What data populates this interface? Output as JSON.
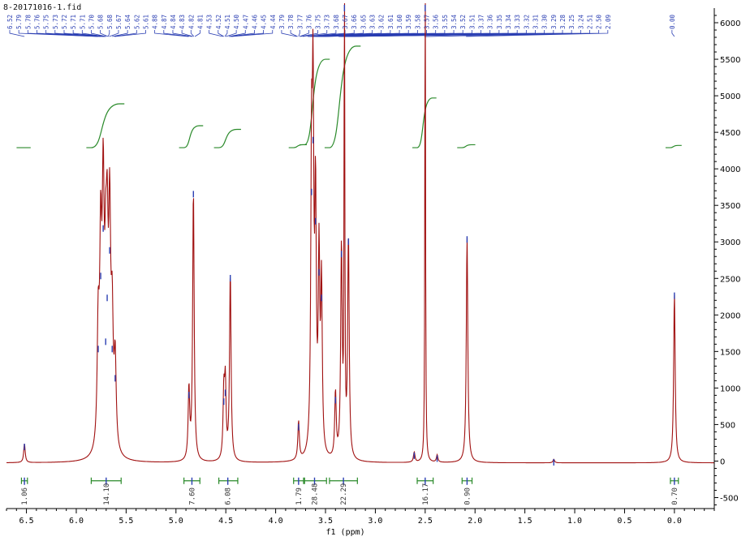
{
  "chart_data": {
    "type": "line",
    "title": "8-20171016-1.fid",
    "xlabel": "f1 (ppm)",
    "ylabel": "",
    "xlim": [
      6.7,
      -0.4
    ],
    "ylim": [
      -650,
      6200
    ],
    "x_ticks": [
      "6.5",
      "6.0",
      "5.5",
      "5.0",
      "4.5",
      "4.0",
      "3.5",
      "3.0",
      "2.5",
      "2.0",
      "1.5",
      "1.0",
      "0.5",
      "0.0"
    ],
    "y_ticks": [
      "-500",
      "0",
      "500",
      "1000",
      "1500",
      "2000",
      "2500",
      "3000",
      "3500",
      "4000",
      "4500",
      "5000",
      "5500",
      "6000"
    ],
    "peaks": [
      {
        "ppm": 6.52,
        "height": 260
      },
      {
        "ppm": 5.78,
        "height": 1600
      },
      {
        "ppm": 5.755,
        "height": 2600
      },
      {
        "ppm": 5.73,
        "height": 3250
      },
      {
        "ppm": 5.705,
        "height": 1700
      },
      {
        "ppm": 5.69,
        "height": 2300
      },
      {
        "ppm": 5.665,
        "height": 2950
      },
      {
        "ppm": 5.64,
        "height": 1600
      },
      {
        "ppm": 5.61,
        "height": 1200
      },
      {
        "ppm": 4.87,
        "height": 970
      },
      {
        "ppm": 4.825,
        "height": 3720
      },
      {
        "ppm": 4.52,
        "height": 880
      },
      {
        "ppm": 4.505,
        "height": 1000
      },
      {
        "ppm": 4.455,
        "height": 2570
      },
      {
        "ppm": 3.77,
        "height": 530
      },
      {
        "ppm": 3.64,
        "height": 3750
      },
      {
        "ppm": 3.625,
        "height": 4460
      },
      {
        "ppm": 3.6,
        "height": 3350
      },
      {
        "ppm": 3.565,
        "height": 2650
      },
      {
        "ppm": 3.54,
        "height": 2300
      },
      {
        "ppm": 3.4,
        "height": 900
      },
      {
        "ppm": 3.34,
        "height": 2900
      },
      {
        "ppm": 3.31,
        "height": 7200
      },
      {
        "ppm": 3.27,
        "height": 3070
      },
      {
        "ppm": 2.61,
        "height": 140
      },
      {
        "ppm": 2.5,
        "height": 7200
      },
      {
        "ppm": 2.38,
        "height": 100
      },
      {
        "ppm": 2.08,
        "height": 3100
      },
      {
        "ppm": 1.21,
        "height": 50
      },
      {
        "ppm": 0.0,
        "height": 2330
      }
    ],
    "peak_labels": [
      "6.52",
      "5.79",
      "5.78",
      "5.76",
      "5.75",
      "5.73",
      "5.72",
      "5.71",
      "5.71",
      "5.70",
      "5.68",
      "5.68",
      "5.67",
      "5.64",
      "5.62",
      "5.61",
      "4.88",
      "4.87",
      "4.84",
      "4.83",
      "4.82",
      "4.81",
      "4.53",
      "4.52",
      "4.51",
      "4.50",
      "4.47",
      "4.46",
      "4.45",
      "4.44",
      "3.79",
      "3.78",
      "3.77",
      "3.76",
      "3.75",
      "3.73",
      "3.68",
      "3.67",
      "3.66",
      "3.65",
      "3.63",
      "3.62",
      "3.61",
      "3.60",
      "3.59",
      "3.58",
      "3.57",
      "3.56",
      "3.55",
      "3.54",
      "3.52",
      "3.51",
      "3.37",
      "3.36",
      "3.35",
      "3.34",
      "3.33",
      "3.32",
      "3.31",
      "3.30",
      "3.29",
      "3.28",
      "3.25",
      "3.24",
      "2.51",
      "2.50",
      "2.09",
      "0.00"
    ],
    "integrals": [
      {
        "value": "1.06",
        "center": 6.52,
        "from": 6.55,
        "to": 6.49,
        "curve_base": 4290,
        "curve_top": 4290
      },
      {
        "value": "14.10",
        "center": 5.7,
        "from": 5.85,
        "to": 5.55,
        "curve_base": 4290,
        "curve_top": 4890
      },
      {
        "value": "7.60",
        "center": 4.84,
        "from": 4.92,
        "to": 4.76,
        "curve_base": 4290,
        "curve_top": 4590
      },
      {
        "value": "6.08",
        "center": 4.48,
        "from": 4.57,
        "to": 4.38,
        "curve_base": 4290,
        "curve_top": 4540
      },
      {
        "value": "1.79",
        "center": 3.77,
        "from": 3.82,
        "to": 3.72,
        "curve_base": 4290,
        "curve_top": 4330
      },
      {
        "value": "28.48",
        "center": 3.61,
        "from": 3.71,
        "to": 3.49,
        "curve_base": 4330,
        "curve_top": 5500
      },
      {
        "value": "22.29",
        "center": 3.32,
        "from": 3.46,
        "to": 3.18,
        "curve_base": 4290,
        "curve_top": 5680
      },
      {
        "value": "16.17",
        "center": 2.5,
        "from": 2.58,
        "to": 2.42,
        "curve_base": 4290,
        "curve_top": 4970
      },
      {
        "value": "0.90",
        "center": 2.08,
        "from": 2.13,
        "to": 2.03,
        "curve_base": 4290,
        "curve_top": 4330
      },
      {
        "value": "0.70",
        "center": 0.0,
        "from": 0.04,
        "to": -0.04,
        "curve_base": 4290,
        "curve_top": 4320
      }
    ],
    "colors": {
      "spectrum": "#a01010",
      "peak_marker": "#2b3fb3",
      "integral": "#2a8a2a",
      "peak_label": "#2b3fb3",
      "axis": "#000000"
    },
    "grid": false,
    "y_axis_side": "right"
  }
}
